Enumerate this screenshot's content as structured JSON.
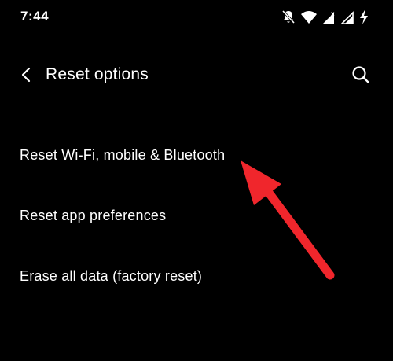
{
  "status_bar": {
    "time": "7:44",
    "icons": [
      "bell-muted-icon",
      "wifi-icon",
      "signal-no-sim-icon",
      "signal-icon",
      "battery-charging-icon"
    ]
  },
  "app_bar": {
    "back_icon": "chevron-left-icon",
    "title": "Reset options",
    "search_icon": "search-icon"
  },
  "options": [
    {
      "label": "Reset Wi-Fi, mobile & Bluetooth"
    },
    {
      "label": "Reset app preferences"
    },
    {
      "label": "Erase all data (factory reset)"
    }
  ],
  "annotation": {
    "arrow_color": "#f0262c",
    "points_to": "Reset Wi-Fi, mobile & Bluetooth"
  },
  "theme": {
    "background": "#000000",
    "text": "#ffffff"
  }
}
